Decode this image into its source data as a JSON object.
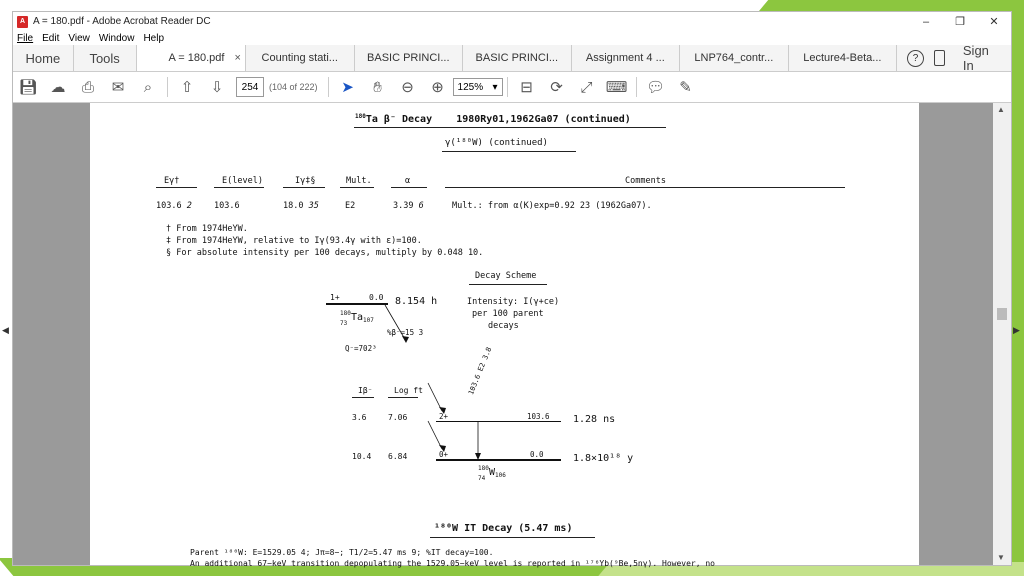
{
  "window": {
    "title": "A = 180.pdf - Adobe Acrobat Reader DC",
    "icon": "pdf-icon",
    "min": "–",
    "max": "❐",
    "close": "✕"
  },
  "menu": [
    "File",
    "Edit",
    "View",
    "Window",
    "Help"
  ],
  "tabs": {
    "home": "Home",
    "tools": "Tools",
    "active": "A = 180.pdf",
    "active_close": "×",
    "docs": [
      "Counting stati...",
      "BASIC PRINCI...",
      "BASIC PRINCI...",
      "Assignment 4 ...",
      "LNP764_contr...",
      "Lecture4-Beta..."
    ],
    "help": "?",
    "signin": "Sign In"
  },
  "toolbar": {
    "page": "254",
    "page_count": "(104 of 222)",
    "zoom": "125%",
    "zoom_arrow": "▾"
  },
  "doc": {
    "heading_nuclide": "180",
    "heading_ta": "Ta",
    "heading_decay": "β⁻ Decay",
    "heading_ref": "1980Ry01,1962Ga07 (continued)",
    "subheading": "γ(¹⁸⁰W) (continued)",
    "cols": [
      "Eγ†",
      "E(level)",
      "Iγ‡§",
      "Mult.",
      "α",
      "Comments"
    ],
    "row": {
      "eg": "103.6",
      "eg_unc": "2",
      "elevel": "103.6",
      "ig": "18.0",
      "ig_unc": "35",
      "mult": "E2",
      "alpha": "3.39",
      "alpha_unc": "6",
      "comment": "Mult.: from α(K)exp=0.92 23 (1962Ga07)."
    },
    "footnotes": [
      {
        "mark": "†",
        "text": "From 1974HeYW."
      },
      {
        "mark": "‡",
        "text": "From 1974HeYW, relative to Iγ(93.4γ with ε)=100."
      },
      {
        "mark": "§",
        "text": "For absolute intensity per 100 decays, multiply by 0.048 10."
      }
    ],
    "scheme_title": "Decay Scheme",
    "intensity_note": [
      "Intensity: I(γ+ce)",
      "per 100 parent",
      "decays"
    ],
    "parent": {
      "jpi": "1+",
      "energy": "0.0",
      "halflife": "8.154 h",
      "mass": "180",
      "z": "73",
      "sym": "Ta",
      "n": "107",
      "branch": "%β⁻=15 3",
      "q": "Q⁻=702³"
    },
    "gamma_label": "103.6 E2 3.8",
    "ib_head": "Iβ⁻",
    "logft_head": "Log ft",
    "levels": [
      {
        "ib": "3.6",
        "logft": "7.06",
        "jpi": "2+",
        "energy": "103.6",
        "halflife": "1.28 ns"
      },
      {
        "ib": "10.4",
        "logft": "6.84",
        "jpi": "0+",
        "energy": "0.0",
        "halflife": "1.8×10¹⁸ y"
      }
    ],
    "daughter": {
      "mass": "180",
      "z": "74",
      "sym": "W",
      "n": "106"
    },
    "it_heading": "¹⁸⁰W IT Decay (5.47 ms)",
    "parent_line": "Parent ¹⁸⁰W: E=1529.05 4; Jπ=8−; T1/2=5.47 ms 9; %IT decay=100.",
    "additional_line": "An additional 67−keV transition depopulating the 1529.05−keV level is reported in ¹⁷⁶Yb(⁹Be,5nγ). However, no"
  }
}
